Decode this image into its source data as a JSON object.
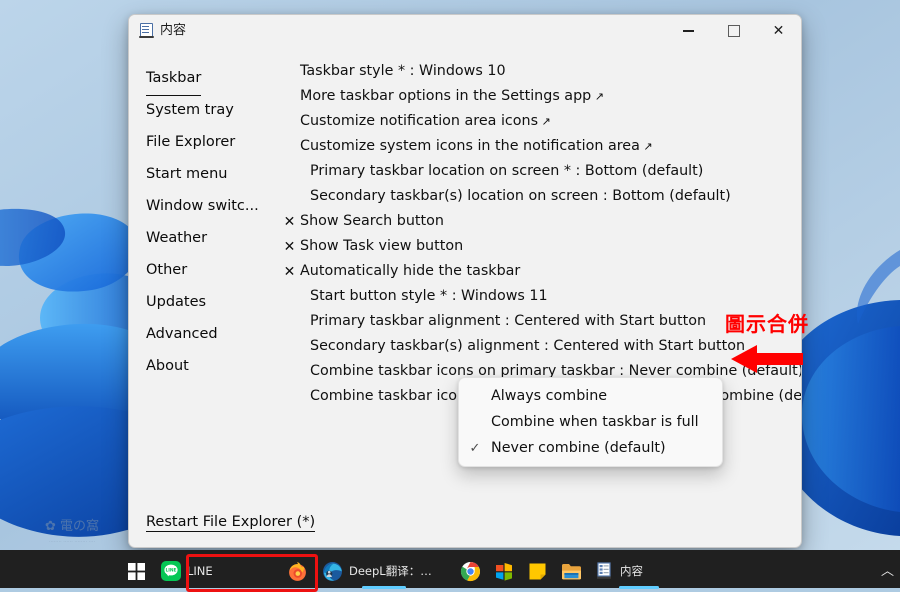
{
  "window": {
    "title": "内容",
    "title_icon": "app-list-icon",
    "controls": {
      "minimize": "–",
      "maximize": "□",
      "close": "✕"
    }
  },
  "sidebar": {
    "items": [
      {
        "label": "Taskbar",
        "active": true
      },
      {
        "label": "System tray",
        "active": false
      },
      {
        "label": "File Explorer",
        "active": false
      },
      {
        "label": "Start menu",
        "active": false
      },
      {
        "label": "Window switc...",
        "active": false
      },
      {
        "label": "Weather",
        "active": false
      },
      {
        "label": "Other",
        "active": false
      },
      {
        "label": "Updates",
        "active": false
      },
      {
        "label": "Advanced",
        "active": false
      },
      {
        "label": "About",
        "active": false
      }
    ],
    "restart_link": "Restart File Explorer (*)"
  },
  "content": {
    "rows": [
      {
        "mark": "",
        "text": "Taskbar style * : Windows 10",
        "indent": false,
        "ext": false
      },
      {
        "mark": "",
        "text": "More taskbar options in the Settings app",
        "indent": false,
        "ext": true
      },
      {
        "mark": "",
        "text": "Customize notification area icons",
        "indent": false,
        "ext": true
      },
      {
        "mark": "",
        "text": "Customize system icons in the notification area",
        "indent": false,
        "ext": true
      },
      {
        "mark": "",
        "text": "Primary taskbar location on screen * : Bottom (default)",
        "indent": true,
        "ext": false
      },
      {
        "mark": "",
        "text": "Secondary taskbar(s) location on screen : Bottom (default)",
        "indent": true,
        "ext": false
      },
      {
        "mark": "✕",
        "text": "Show Search button",
        "indent": false,
        "ext": false
      },
      {
        "mark": "✕",
        "text": "Show Task view button",
        "indent": false,
        "ext": false
      },
      {
        "mark": "✕",
        "text": "Automatically hide the taskbar",
        "indent": false,
        "ext": false
      },
      {
        "mark": "",
        "text": "Start button style * : Windows 11",
        "indent": true,
        "ext": false
      },
      {
        "mark": "",
        "text": "Primary taskbar alignment : Centered with Start button",
        "indent": true,
        "ext": false
      },
      {
        "mark": "",
        "text": "Secondary taskbar(s) alignment : Centered with Start button",
        "indent": true,
        "ext": false
      },
      {
        "mark": "",
        "text": "Combine taskbar icons on primary taskbar : Never combine (default)",
        "indent": true,
        "ext": false
      },
      {
        "mark": "",
        "text": "Combine taskbar icons on secondary taskbar(s) : Never combine (default)",
        "indent": true,
        "ext": false
      }
    ]
  },
  "dropdown": {
    "options": [
      {
        "label": "Always combine",
        "checked": false
      },
      {
        "label": "Combine when taskbar is full",
        "checked": false
      },
      {
        "label": "Never combine (default)",
        "checked": true
      }
    ],
    "check_glyph": "✓"
  },
  "annotation": {
    "text": "圖示合併",
    "color": "#ff0000",
    "arrow": "left-arrow-icon",
    "highlight_color": "#ee1111"
  },
  "taskbar": {
    "start_label": "start-button",
    "items": [
      {
        "name": "line",
        "label": "LINE",
        "active": false,
        "highlighted": true
      },
      {
        "name": "firefox",
        "label": "",
        "active": false,
        "highlighted": false
      },
      {
        "name": "edge",
        "label": "DeepL翻译：全世...",
        "active": true,
        "highlighted": false
      },
      {
        "name": "chrome",
        "label": "",
        "active": false,
        "highlighted": false
      },
      {
        "name": "microsoft-store",
        "label": "",
        "active": false,
        "highlighted": false
      },
      {
        "name": "sticky-notes",
        "label": "",
        "active": false,
        "highlighted": false
      },
      {
        "name": "file-explorer",
        "label": "",
        "active": false,
        "highlighted": false
      },
      {
        "name": "content-app",
        "label": "内容",
        "active": true,
        "highlighted": false
      }
    ],
    "tray_chevron": "︿"
  }
}
